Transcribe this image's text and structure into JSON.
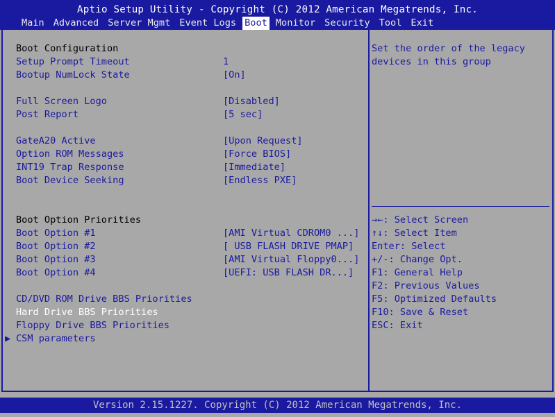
{
  "header": {
    "title": "Aptio Setup Utility - Copyright (C) 2012 American Megatrends, Inc.",
    "tabs": [
      "Main",
      "Advanced",
      "Server Mgmt",
      "Event Logs",
      "Boot",
      "Monitor",
      "Security",
      "Tool",
      "Exit"
    ],
    "active_tab": "Boot"
  },
  "left": {
    "boot_config_heading": "Boot Configuration",
    "setup_prompt_timeout": {
      "label": "Setup Prompt Timeout",
      "value": "1"
    },
    "bootup_numlock": {
      "label": "Bootup NumLock State",
      "value": "[On]"
    },
    "full_screen_logo": {
      "label": "Full Screen Logo",
      "value": "[Disabled]"
    },
    "post_report": {
      "label": "Post Report",
      "value": "[5 sec]"
    },
    "gatea20": {
      "label": "GateA20 Active",
      "value": "[Upon Request]"
    },
    "option_rom": {
      "label": "Option ROM Messages",
      "value": "[Force BIOS]"
    },
    "int19": {
      "label": "INT19 Trap Response",
      "value": "[Immediate]"
    },
    "boot_device_seeking": {
      "label": "Boot Device Seeking",
      "value": "[Endless PXE]"
    },
    "boot_priorities_heading": "Boot Option Priorities",
    "boot_option_1": {
      "label": "Boot Option #1",
      "value": "[AMI Virtual CDROM0 ...]"
    },
    "boot_option_2": {
      "label": "Boot Option #2",
      "value": "[ USB FLASH DRIVE PMAP]"
    },
    "boot_option_3": {
      "label": "Boot Option #3",
      "value": "[AMI Virtual Floppy0...]"
    },
    "boot_option_4": {
      "label": "Boot Option #4",
      "value": "[UEFI:  USB FLASH DR...]"
    },
    "cd_dvd_bbs": "CD/DVD ROM Drive BBS Priorities",
    "hard_drive_bbs": "Hard Drive BBS Priorities",
    "floppy_bbs": "Floppy Drive BBS Priorities",
    "csm_parameters": "CSM parameters"
  },
  "help": {
    "line1": "Set the order of the legacy",
    "line2": "devices in this group"
  },
  "keys": [
    "→←: Select Screen",
    "↑↓: Select Item",
    "Enter: Select",
    "+/-: Change Opt.",
    "F1: General Help",
    "F2: Previous Values",
    "F5: Optimized Defaults",
    "F10: Save & Reset",
    "ESC: Exit"
  ],
  "footer": "Version 2.15.1227. Copyright (C) 2012 American Megatrends, Inc.",
  "colors": {
    "background": "#a8a8a8",
    "accent": "#1a1aa0",
    "highlight": "#ffffff"
  }
}
